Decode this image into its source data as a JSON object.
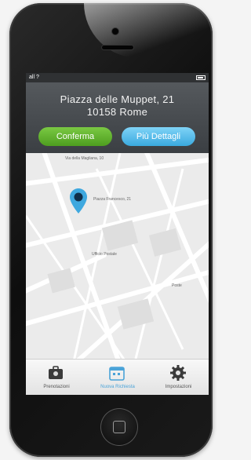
{
  "status_bar": {
    "carrier": "all ?",
    "time": "",
    "battery": "battery-icon"
  },
  "header": {
    "address_line1": "Piazza delle Muppet, 21",
    "address_line2": "10158 Rome"
  },
  "buttons": {
    "confirm_label": "Conferma",
    "more_label": "Più Dettagli"
  },
  "map": {
    "labels": {
      "street_top": "Via della Magliana, 10",
      "poi_1": "Piazza Francesco, 21",
      "poi_2": "Ufficio Postale",
      "poi_3": "Poste"
    }
  },
  "tabbar": {
    "items": [
      {
        "label": "Prenotazioni",
        "icon": "briefcase-icon"
      },
      {
        "label": "Nuova Richiesta",
        "icon": "calendar-icon"
      },
      {
        "label": "Impostazioni",
        "icon": "gear-icon"
      }
    ]
  },
  "colors": {
    "confirm": "#5aad2a",
    "more": "#4db6e8",
    "header": "#474b4f",
    "pin": "#3ea8df",
    "active_tab": "#4aa3d8"
  }
}
